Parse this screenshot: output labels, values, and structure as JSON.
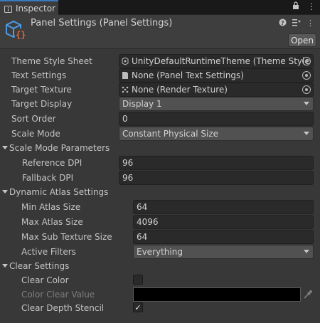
{
  "tab": {
    "label": "Inspector"
  },
  "header": {
    "title": "Panel Settings (Panel Settings)",
    "open_label": "Open",
    "help_icon": "help-icon",
    "settings_icon": "settings-icon",
    "more_icon": "more-icon"
  },
  "fields": {
    "theme_style_sheet": {
      "label": "Theme Style Sheet",
      "value": "UnityDefaultRuntimeTheme (Theme Style"
    },
    "text_settings": {
      "label": "Text Settings",
      "value": "None (Panel Text Settings)"
    },
    "target_texture": {
      "label": "Target Texture",
      "value": "None (Render Texture)"
    },
    "target_display": {
      "label": "Target Display",
      "value": "Display 1"
    },
    "sort_order": {
      "label": "Sort Order",
      "value": "0"
    },
    "scale_mode": {
      "label": "Scale Mode",
      "value": "Constant Physical Size"
    }
  },
  "scale_params": {
    "header": "Scale Mode Parameters",
    "reference_dpi": {
      "label": "Reference DPI",
      "value": "96"
    },
    "fallback_dpi": {
      "label": "Fallback DPI",
      "value": "96"
    }
  },
  "atlas": {
    "header": "Dynamic Atlas Settings",
    "min_atlas": {
      "label": "Min Atlas Size",
      "value": "64"
    },
    "max_atlas": {
      "label": "Max Atlas Size",
      "value": "4096"
    },
    "max_sub": {
      "label": "Max Sub Texture Size",
      "value": "64"
    },
    "filters": {
      "label": "Active Filters",
      "value": "Everything"
    }
  },
  "clear": {
    "header": "Clear Settings",
    "clear_color": {
      "label": "Clear Color",
      "checked": false
    },
    "color_clear_value": {
      "label": "Color Clear Value",
      "color": "#000000"
    },
    "clear_depth": {
      "label": "Clear Depth Stencil",
      "checked": true,
      "mark": "✓"
    }
  },
  "colors": {
    "accent": "#3a79bb",
    "background": "#383838"
  }
}
